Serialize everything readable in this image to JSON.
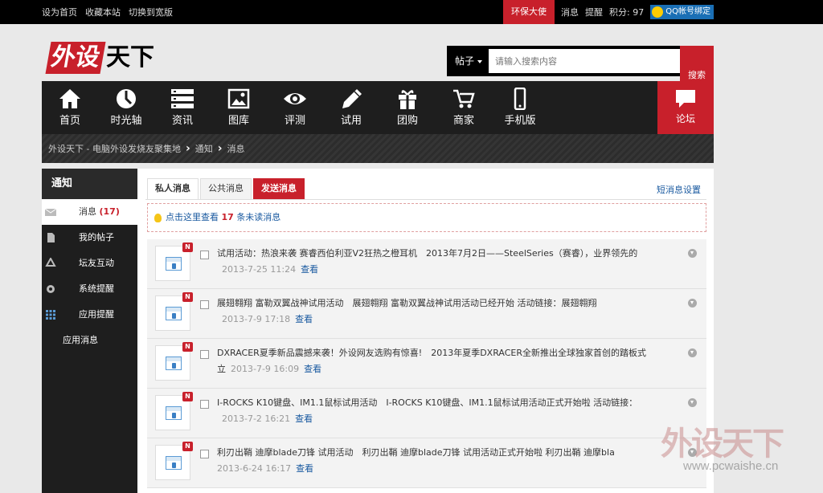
{
  "topbar": {
    "left_links": [
      "设为首页",
      "收藏本站",
      "切换到宽版"
    ],
    "promo": "环保大使",
    "messages": "消息",
    "reminders": "提醒",
    "points": "积分: 97",
    "qq_bind": "QQ帐号绑定"
  },
  "logo": {
    "part1": "外设",
    "part2": "天下"
  },
  "search": {
    "scope": "帖子",
    "placeholder": "请输入搜索内容",
    "button": "搜索"
  },
  "nav": {
    "items": [
      {
        "label": "首页",
        "icon": "home-icon"
      },
      {
        "label": "时光轴",
        "icon": "clock-icon"
      },
      {
        "label": "资讯",
        "icon": "list-icon"
      },
      {
        "label": "图库",
        "icon": "image-icon"
      },
      {
        "label": "评测",
        "icon": "eye-icon"
      },
      {
        "label": "试用",
        "icon": "pencil-icon"
      },
      {
        "label": "团购",
        "icon": "gift-icon"
      },
      {
        "label": "商家",
        "icon": "cart-icon"
      },
      {
        "label": "手机版",
        "icon": "phone-icon"
      }
    ],
    "forum": "论坛"
  },
  "breadcrumb": [
    "外设天下 - 电脑外设发烧友聚集地",
    "通知",
    "消息"
  ],
  "sidebar": {
    "title": "通知",
    "items": [
      {
        "label": "消息",
        "count": "(17)",
        "icon": "envelope-icon"
      },
      {
        "label": "我的帖子",
        "icon": "document-icon"
      },
      {
        "label": "坛友互动",
        "icon": "recycle-icon"
      },
      {
        "label": "系统提醒",
        "icon": "gear-icon"
      },
      {
        "label": "应用提醒",
        "icon": "grid-icon"
      },
      {
        "label": "应用消息"
      }
    ]
  },
  "main": {
    "tabs": [
      "私人消息",
      "公共消息",
      "发送消息"
    ],
    "settings": "短消息设置",
    "notice": {
      "prefix": "点击这里查看",
      "count": "17",
      "suffix": "条未读消息"
    },
    "messages": [
      {
        "badge": "N",
        "title": "试用活动：热浪来袭 赛睿西伯利亚V2狂热之橙耳机　2013年7月2日——SteelSeries（赛睿），业界领先的",
        "date": "2013-7-25 11:24",
        "view": "查看"
      },
      {
        "badge": "N",
        "title": "展翅翱翔 富勒双翼战神试用活动　展翅翱翔 富勒双翼战神试用活动已经开始 活动链接：展翅翱翔",
        "date": "2013-7-9 17:18",
        "view": "查看"
      },
      {
        "badge": "N",
        "title": "DXRACER夏季新品震撼来袭！外设网友选购有惊喜!　2013年夏季DXRACER全新推出全球独家首创的踏板式立",
        "date": "2013-7-9 16:09",
        "view": "查看"
      },
      {
        "badge": "N",
        "title": "I-ROCKS K10键盘、IM1.1鼠标试用活动　I-ROCKS K10键盘、IM1.1鼠标试用活动正式开始啦 活动链接：",
        "date": "2013-7-2 16:21",
        "view": "查看"
      },
      {
        "badge": "N",
        "title": "利刃出鞘 迪摩blade刀锋 试用活动　利刃出鞘 迪摩blade刀锋 试用活动正式开始啦 利刃出鞘 迪摩bla",
        "date": "2013-6-24 16:17",
        "view": "查看"
      }
    ]
  },
  "watermark": {
    "logo": "外设天下",
    "url": "www.pcwaishe.cn"
  },
  "colors": {
    "accent": "#c8202b",
    "nav_bg": "#1e1e1e",
    "link": "#1a5aa0"
  }
}
